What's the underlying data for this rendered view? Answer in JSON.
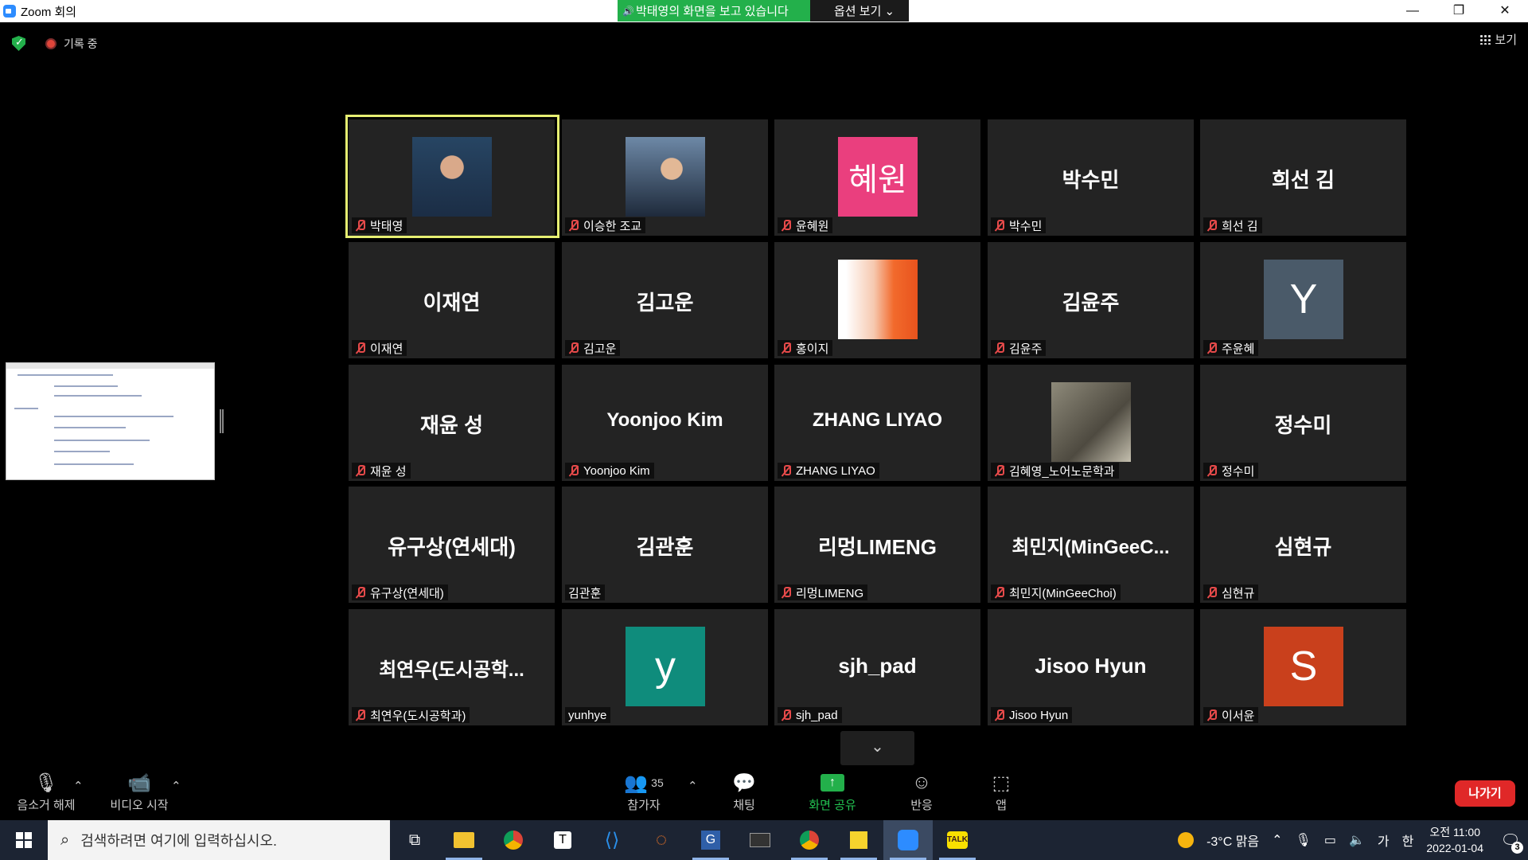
{
  "window": {
    "title": "Zoom 회의",
    "min": "—",
    "restore": "❐",
    "close": "✕"
  },
  "share_banner": {
    "text": "박태영의 화면을 보고 있습니다",
    "options": "옵션 보기 ⌄"
  },
  "meeting_bar": {
    "recording": "기록 중",
    "view": "보기"
  },
  "gallery": {
    "tiles": [
      {
        "name": "박태영",
        "display": "",
        "type": "photo",
        "bg": "#2c4060"
      },
      {
        "name": "이승한 조교",
        "display": "",
        "type": "photo2",
        "bg": "#2f4a66"
      },
      {
        "name": "윤혜원",
        "display": "혜원",
        "type": "avatar",
        "bg": "#ea3f7e"
      },
      {
        "name": "박수민",
        "display": "박수민",
        "type": "text"
      },
      {
        "name": "희선 김",
        "display": "희선 김",
        "type": "text"
      },
      {
        "name": "이재연",
        "display": "이재연",
        "type": "text"
      },
      {
        "name": "김고운",
        "display": "김고운",
        "type": "text"
      },
      {
        "name": "홍이지",
        "display": "",
        "type": "gradient"
      },
      {
        "name": "김윤주",
        "display": "김윤주",
        "type": "text"
      },
      {
        "name": "주윤혜",
        "display": "Y",
        "type": "avatar",
        "bg": "#4a5a69"
      },
      {
        "name": "재윤 성",
        "display": "재윤 성",
        "type": "text"
      },
      {
        "name": "Yoonjoo Kim",
        "display": "Yoonjoo Kim",
        "type": "text"
      },
      {
        "name": "ZHANG LIYAO",
        "display": "ZHANG LIYAO",
        "type": "text"
      },
      {
        "name": "김혜영_노어노문학과",
        "display": "",
        "type": "photo3",
        "bg": "#6d6558"
      },
      {
        "name": "정수미",
        "display": "정수미",
        "type": "text"
      },
      {
        "name": "유구상(연세대)",
        "display": "유구상(연세대)",
        "type": "text"
      },
      {
        "name": "김관훈",
        "display": "김관훈",
        "type": "text",
        "unmuted": true
      },
      {
        "name": "리멍LIMENG",
        "display": "리멍LIMENG",
        "type": "text"
      },
      {
        "name": "최민지(MinGeeChoi)",
        "display": "최민지(MinGeeC...",
        "type": "text"
      },
      {
        "name": "심현규",
        "display": "심현규",
        "type": "text"
      },
      {
        "name": "최연우(도시공학과)",
        "display": "최연우(도시공학...",
        "type": "text"
      },
      {
        "name": "yunhye",
        "display": "y",
        "type": "avatar",
        "bg": "#0f8c7c",
        "unmuted": true
      },
      {
        "name": "sjh_pad",
        "display": "sjh_pad",
        "type": "text"
      },
      {
        "name": "Jisoo Hyun",
        "display": "Jisoo Hyun",
        "type": "text"
      },
      {
        "name": "이서윤",
        "display": "S",
        "type": "avatar",
        "bg": "#c9401c"
      }
    ],
    "more_arrow": "⌄"
  },
  "controls": {
    "unmute": "음소거 해제",
    "start_video": "비디오 시작",
    "participants": "참가자",
    "participant_count": "35",
    "chat": "채팅",
    "share_screen": "화면 공유",
    "reactions": "반응",
    "apps": "앱",
    "leave": "나가기"
  },
  "taskbar": {
    "search_placeholder": "검색하려면 여기에 입력하십시오.",
    "weather": "-3°C  맑음",
    "ime": "가",
    "lang": "한",
    "time": "오전 11:00",
    "date": "2022-01-04",
    "notifications": "3"
  }
}
